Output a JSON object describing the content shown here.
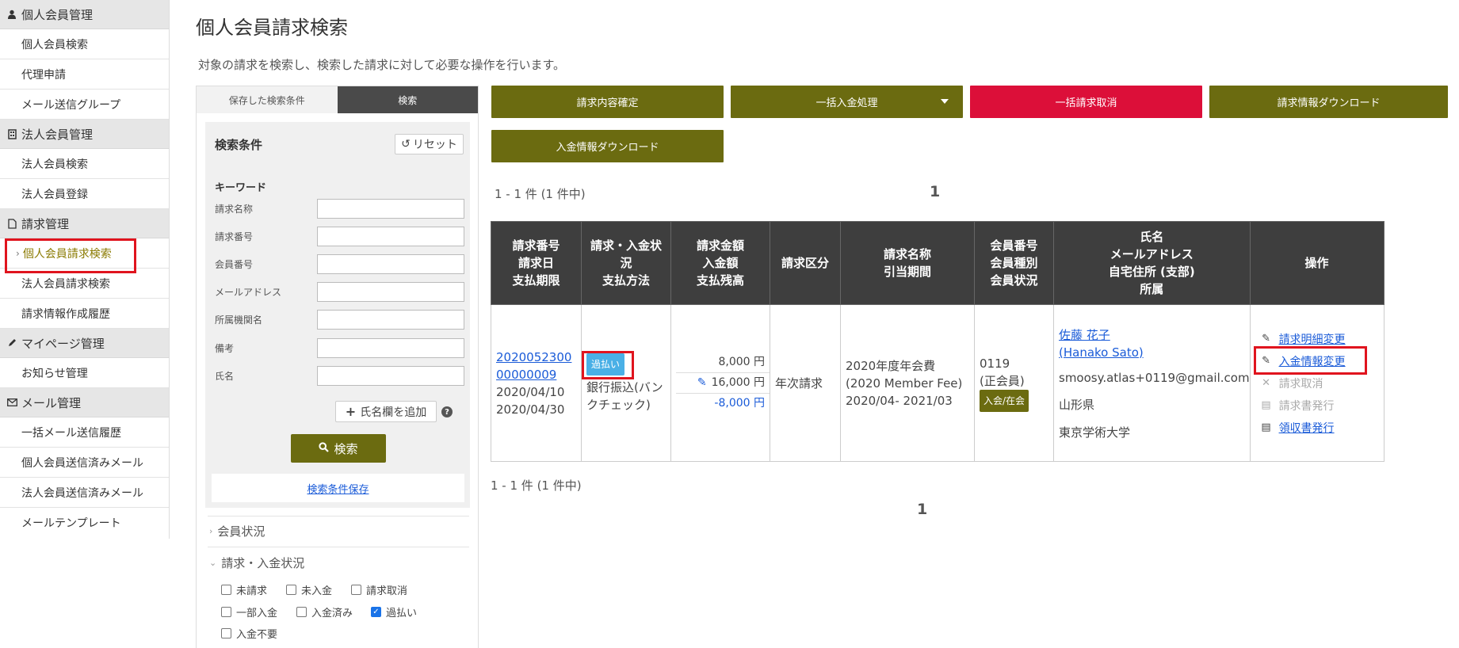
{
  "sidebar": {
    "sections": [
      {
        "title": "個人会員管理",
        "icon": "person-icon",
        "items": [
          "個人会員検索",
          "代理申請",
          "メール送信グループ"
        ]
      },
      {
        "title": "法人会員管理",
        "icon": "building-icon",
        "items": [
          "法人会員検索",
          "法人会員登録"
        ]
      },
      {
        "title": "請求管理",
        "icon": "document-icon",
        "items": [
          "個人会員請求検索",
          "法人会員請求検索",
          "請求情報作成履歴"
        ]
      },
      {
        "title": "マイページ管理",
        "icon": "pen-icon",
        "items": [
          "お知らせ管理"
        ]
      },
      {
        "title": "メール管理",
        "icon": "mail-icon",
        "items": [
          "一括メール送信履歴",
          "個人会員送信済みメール",
          "法人会員送信済みメール",
          "メールテンプレート"
        ]
      }
    ],
    "active_item": "個人会員請求検索"
  },
  "page": {
    "title": "個人会員請求検索",
    "description": "対象の請求を検索し、検索した請求に対して必要な操作を行います。"
  },
  "search_panel": {
    "tabs": [
      "保存した検索条件",
      "検索"
    ],
    "box_title": "検索条件",
    "reset_label": "リセット",
    "keyword_label": "キーワード",
    "fields": [
      {
        "label": "請求名称",
        "value": ""
      },
      {
        "label": "請求番号",
        "value": ""
      },
      {
        "label": "会員番号",
        "value": ""
      },
      {
        "label": "メールアドレス",
        "value": ""
      },
      {
        "label": "所属機関名",
        "value": ""
      },
      {
        "label": "備考",
        "value": ""
      },
      {
        "label": "氏名",
        "value": ""
      }
    ],
    "add_name_label": "氏名欄を追加",
    "search_label": "検索",
    "save_condition_label": "検索条件保存",
    "accordion": [
      "会員状況",
      "請求・入金状況"
    ],
    "checkboxes": [
      {
        "label": "未請求",
        "checked": false
      },
      {
        "label": "未入金",
        "checked": false
      },
      {
        "label": "請求取消",
        "checked": false
      },
      {
        "label": "一部入金",
        "checked": false
      },
      {
        "label": "入金済み",
        "checked": false
      },
      {
        "label": "過払い",
        "checked": true
      },
      {
        "label": "入金不要",
        "checked": false
      }
    ]
  },
  "actions": {
    "confirm": "請求内容確定",
    "bulk_payment": "一括入金処理",
    "bulk_cancel": "一括請求取消",
    "invoice_download": "請求情報ダウンロード",
    "payment_download": "入金情報ダウンロード"
  },
  "pagination": {
    "summary": "1 - 1 件 (1 件中)",
    "page": "1"
  },
  "table": {
    "headers": [
      "請求番号\n請求日\n支払期限",
      "請求・入金状況\n支払方法",
      "請求金額\n入金額\n支払残高",
      "請求区分",
      "請求名称\n引当期間",
      "会員番号\n会員種別\n会員状況",
      "氏名\nメールアドレス\n自宅住所 (支部)\n所属",
      "操作"
    ],
    "row": {
      "invoice_no_1": "2020052300",
      "invoice_no_2": "00000009",
      "invoice_date": "2020/04/10",
      "due_date": "2020/04/30",
      "status_badge": "過払い",
      "payment_method": "銀行振込(バンクチェック)",
      "amount_billed": "8,000 円",
      "amount_paid": "16,000 円",
      "balance": "-8,000 円",
      "category": "年次請求",
      "name_line1": "2020年度年会費",
      "name_line2": "(2020 Member Fee)",
      "period": "2020/04- 2021/03",
      "member_no": "0119",
      "member_type": "(正会員)",
      "member_status": "入会/在会",
      "person_name": "佐藤 花子",
      "person_name_en": "(Hanako Sato)",
      "email": "smoosy.atlas+0119@gmail.com",
      "prefecture": "山形県",
      "affiliation": "東京学術大学",
      "ops": [
        {
          "label": "請求明細変更",
          "icon": "pencil-icon",
          "enabled": true
        },
        {
          "label": "入金情報変更",
          "icon": "pencil-icon",
          "enabled": true
        },
        {
          "label": "請求取消",
          "icon": "x-icon",
          "enabled": false
        },
        {
          "label": "請求書発行",
          "icon": "file-icon",
          "enabled": false
        },
        {
          "label": "領収書発行",
          "icon": "file-icon",
          "enabled": true
        }
      ]
    }
  },
  "colors": {
    "olive": "#6b6b10",
    "red": "#dc0f39",
    "header_dark": "#3e3e3e",
    "highlight": "#e0141e",
    "badge_blue": "#4ab0e6"
  }
}
